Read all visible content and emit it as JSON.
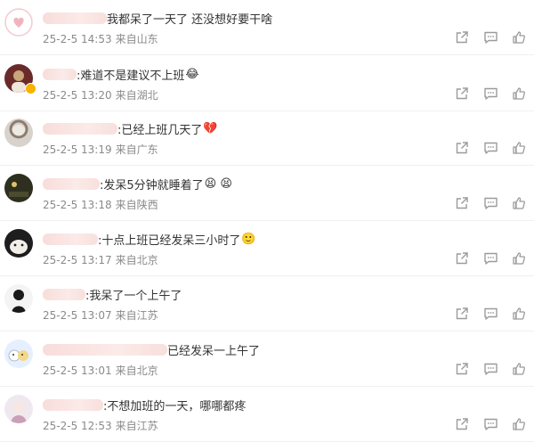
{
  "comments": [
    {
      "text": "我都呆了一天了 还没想好要干啥",
      "emoji": "",
      "time": "25-2-5 14:53",
      "location": "来自山东",
      "badge": false
    },
    {
      "text": ":难道不是建议不上班",
      "emoji": "😂",
      "time": "25-2-5 13:20",
      "location": "来自湖北",
      "badge": true
    },
    {
      "text": ":已经上班几天了",
      "emoji": "💔",
      "time": "25-2-5 13:19",
      "location": "来自广东",
      "badge": false
    },
    {
      "text": ":发呆5分钟就睡着了",
      "emoji": "😫 😫",
      "time": "25-2-5 13:18",
      "location": "来自陕西",
      "badge": false
    },
    {
      "text": ":十点上班已经发呆三小时了",
      "emoji": "🙂",
      "time": "25-2-5 13:17",
      "location": "来自北京",
      "badge": false
    },
    {
      "text": ":我呆了一个上午了",
      "emoji": "",
      "time": "25-2-5 13:07",
      "location": "来自江苏",
      "badge": false
    },
    {
      "text": "已经发呆一上午了",
      "emoji": "",
      "time": "25-2-5 13:01",
      "location": "来自北京",
      "badge": false
    },
    {
      "text": ":不想加班的一天，哪哪都疼",
      "emoji": "",
      "time": "25-2-5 12:53",
      "location": "来自江苏",
      "badge": false
    }
  ],
  "icons": {
    "share": "share-icon",
    "comment": "comment-icon",
    "like": "like-icon"
  },
  "colors": {
    "meta": "#8a8a8a",
    "text": "#333333",
    "icon": "#9b9b9b"
  }
}
